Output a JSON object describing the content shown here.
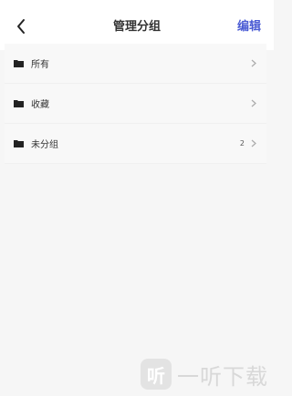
{
  "nav": {
    "title": "管理分组",
    "edit_label": "编辑",
    "back_icon": "chevron-left-icon"
  },
  "groups": [
    {
      "label": "所有",
      "count": "",
      "icon": "folder-icon"
    },
    {
      "label": "收藏",
      "count": "",
      "icon": "folder-icon"
    },
    {
      "label": "未分组",
      "count": "2",
      "icon": "folder-icon"
    }
  ],
  "watermark": {
    "logo_char": "听",
    "text": "一听下载"
  },
  "colors": {
    "accent": "#4a5bd4",
    "background": "#f6f6f6",
    "row_background": "#f8f8f8"
  }
}
